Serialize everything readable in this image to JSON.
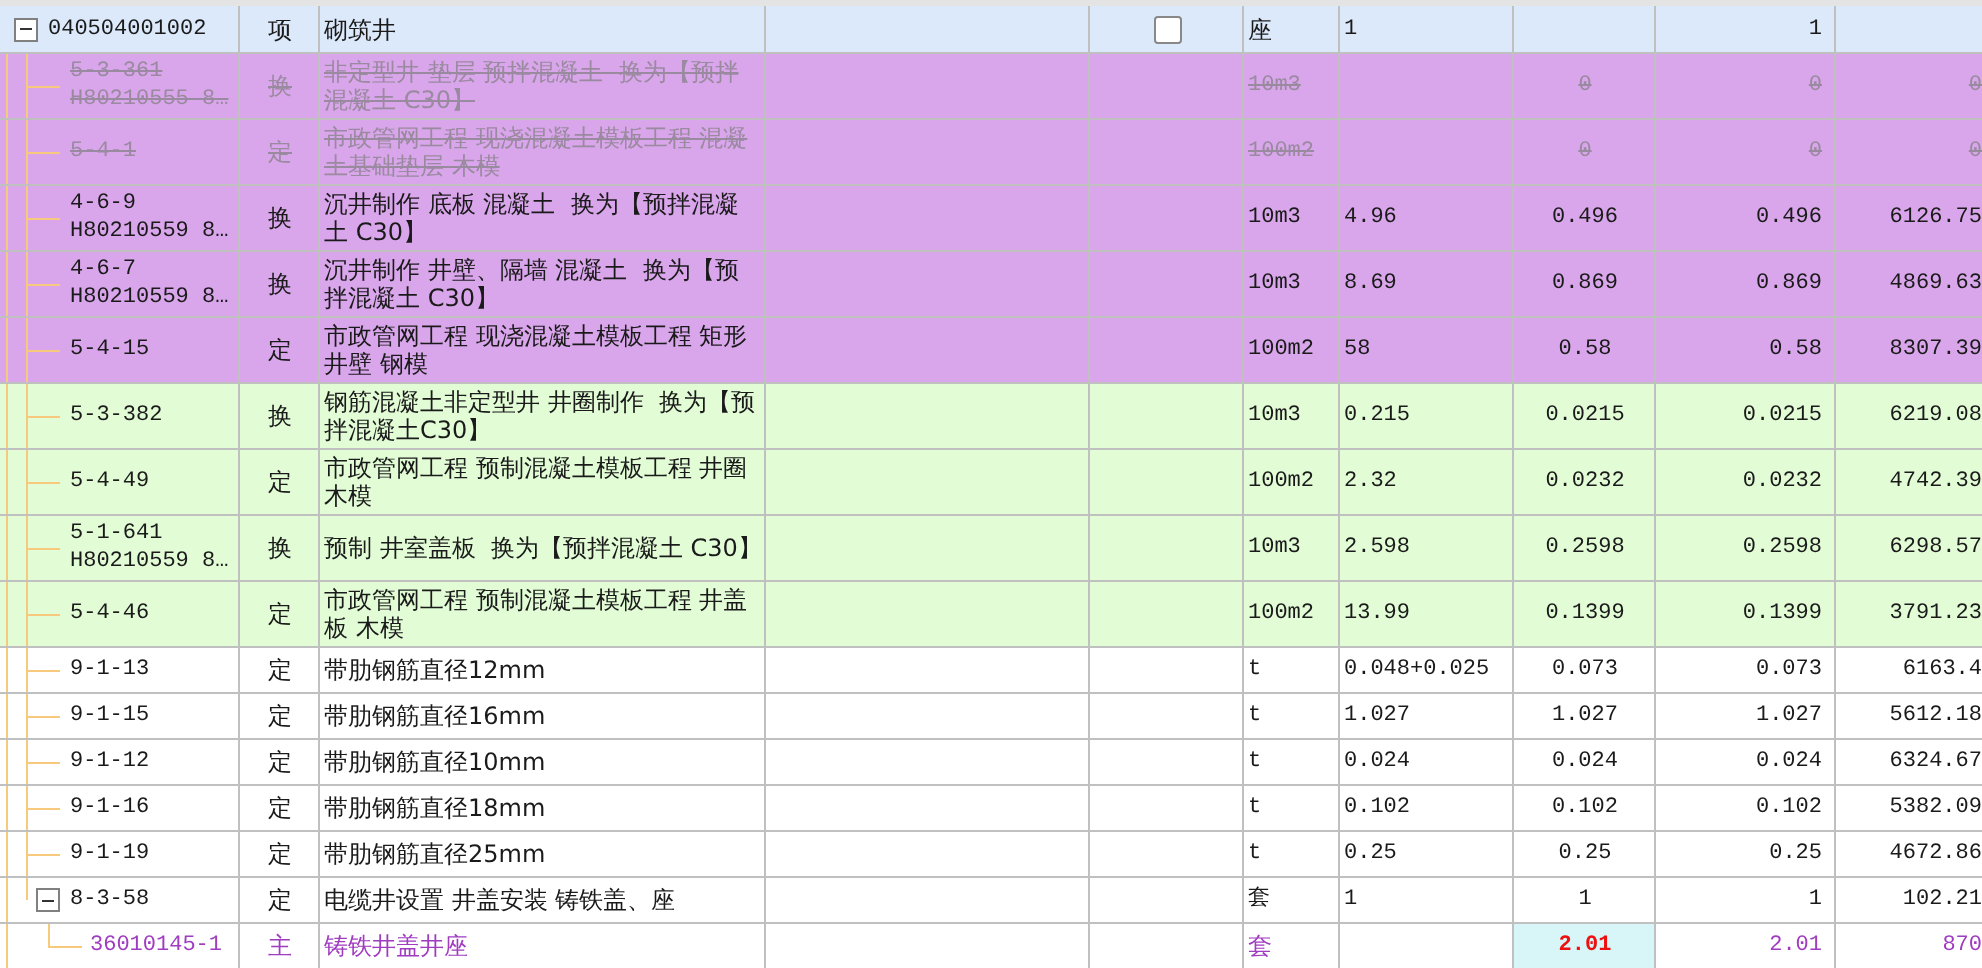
{
  "table": {
    "rows": [
      {
        "kind": "group",
        "column_1": "040504001002",
        "column_2": "项",
        "column_3": "砌筑井",
        "checked": false,
        "column_6": "座",
        "column_7": "1",
        "column_9": "1",
        "color": "#dce9fb",
        "disabled": false,
        "selected": false,
        "expanded": true,
        "children": [
          {
            "kind": "item",
            "column_1": "5-3-361\nH80210555 8…",
            "column_2": "换",
            "column_3": "非定型井 垫层 预拌混凝土  换为【预拌混凝土 C30】",
            "column_6": "10m3",
            "column_8": "0",
            "column_9": "0",
            "column_10": "0",
            "color": "#d9a6eb",
            "disabled": true,
            "selected": false
          },
          {
            "kind": "item",
            "column_1": "5-4-1",
            "column_2": "定",
            "column_3": "市政管网工程 现浇混凝土模板工程 混凝土基础垫层 木模",
            "column_6": "100m2",
            "column_8": "0",
            "column_9": "0",
            "column_10": "0",
            "color": "#d9a6eb",
            "disabled": true,
            "selected": false
          },
          {
            "kind": "item",
            "column_1": "4-6-9\nH80210559 8…",
            "column_2": "换",
            "column_3": "沉井制作 底板 混凝土  换为【预拌混凝土 C30】",
            "column_6": "10m3",
            "column_7": "4.96",
            "column_8": "0.496",
            "column_9": "0.496",
            "column_10": "6126.75",
            "color": "#d9a6eb",
            "disabled": false,
            "selected": false
          },
          {
            "kind": "item",
            "column_1": "4-6-7\nH80210559 8…",
            "column_2": "换",
            "column_3": "沉井制作 井壁、隔墙 混凝土  换为【预拌混凝土 C30】",
            "column_6": "10m3",
            "column_7": "8.69",
            "column_8": "0.869",
            "column_9": "0.869",
            "column_10": "4869.63",
            "color": "#d9a6eb",
            "disabled": false,
            "selected": false
          },
          {
            "kind": "item",
            "column_1": "5-4-15",
            "column_2": "定",
            "column_3": "市政管网工程 现浇混凝土模板工程 矩形井壁 钢模",
            "column_6": "100m2",
            "column_7": "58",
            "column_8": "0.58",
            "column_9": "0.58",
            "column_10": "8307.39",
            "color": "#d9a6eb",
            "disabled": false,
            "selected": false
          },
          {
            "kind": "item",
            "column_1": "5-3-382",
            "column_2": "换",
            "column_3": "钢筋混凝土非定型井 井圈制作  换为【预拌混凝土C30】",
            "column_6": "10m3",
            "column_7": "0.215",
            "column_8": "0.0215",
            "column_9": "0.0215",
            "column_10": "6219.08",
            "color": "#e2fcd6",
            "disabled": false,
            "selected": false
          },
          {
            "kind": "item",
            "column_1": "5-4-49",
            "column_2": "定",
            "column_3": "市政管网工程 预制混凝土模板工程 井圈木模",
            "column_6": "100m2",
            "column_7": "2.32",
            "column_8": "0.0232",
            "column_9": "0.0232",
            "column_10": "4742.39",
            "color": "#e2fcd6",
            "disabled": false,
            "selected": false
          },
          {
            "kind": "item",
            "column_1": "5-1-641\nH80210559 8…",
            "column_2": "换",
            "column_3": "预制 井室盖板  换为【预拌混凝土 C30】",
            "column_6": "10m3",
            "column_7": "2.598",
            "column_8": "0.2598",
            "column_9": "0.2598",
            "column_10": "6298.57",
            "color": "#e2fcd6",
            "disabled": false,
            "selected": false
          },
          {
            "kind": "item",
            "column_1": "5-4-46",
            "column_2": "定",
            "column_3": "市政管网工程 预制混凝土模板工程 井盖板 木模",
            "column_6": "100m2",
            "column_7": "13.99",
            "column_8": "0.1399",
            "column_9": "0.1399",
            "column_10": "3791.23",
            "color": "#e2fcd6",
            "disabled": false,
            "selected": false
          },
          {
            "kind": "item",
            "column_1": "9-1-13",
            "column_2": "定",
            "column_3": "带肋钢筋直径12mm",
            "column_6": "t",
            "column_7": "0.048+0.025",
            "column_8": "0.073",
            "column_9": "0.073",
            "column_10": "6163.4",
            "color": "#ffffff",
            "disabled": false,
            "selected": false
          },
          {
            "kind": "item",
            "column_1": "9-1-15",
            "column_2": "定",
            "column_3": "带肋钢筋直径16mm",
            "column_6": "t",
            "column_7": "1.027",
            "column_8": "1.027",
            "column_9": "1.027",
            "column_10": "5612.18",
            "color": "#ffffff",
            "disabled": false,
            "selected": false
          },
          {
            "kind": "item",
            "column_1": "9-1-12",
            "column_2": "定",
            "column_3": "带肋钢筋直径10mm",
            "column_6": "t",
            "column_7": "0.024",
            "column_8": "0.024",
            "column_9": "0.024",
            "column_10": "6324.67",
            "color": "#ffffff",
            "disabled": false,
            "selected": false
          },
          {
            "kind": "item",
            "column_1": "9-1-16",
            "column_2": "定",
            "column_3": "带肋钢筋直径18mm",
            "column_6": "t",
            "column_7": "0.102",
            "column_8": "0.102",
            "column_9": "0.102",
            "column_10": "5382.09",
            "color": "#ffffff",
            "disabled": false,
            "selected": false
          },
          {
            "kind": "item",
            "column_1": "9-1-19",
            "column_2": "定",
            "column_3": "带肋钢筋直径25mm",
            "column_6": "t",
            "column_7": "0.25",
            "column_8": "0.25",
            "column_9": "0.25",
            "column_10": "4672.86",
            "color": "#ffffff",
            "disabled": false,
            "selected": false
          },
          {
            "kind": "item",
            "column_1": "8-3-58",
            "column_2": "定",
            "column_3": "电缆井设置 井盖安装 铸铁盖、座",
            "column_6": "套",
            "column_7": "1",
            "column_8": "1",
            "column_9": "1",
            "column_10": "102.21",
            "color": "#ffffff",
            "disabled": false,
            "selected": false,
            "expanded": true,
            "children": [
              {
                "kind": "material",
                "column_1": "36010145-1",
                "column_2": "主",
                "column_3": "铸铁井盖井座",
                "column_6": "套",
                "column_8": "2.01",
                "column_9": "2.01",
                "column_10": "870",
                "color": "#ffffff",
                "disabled": false,
                "selected": true
              }
            ]
          }
        ]
      }
    ]
  }
}
